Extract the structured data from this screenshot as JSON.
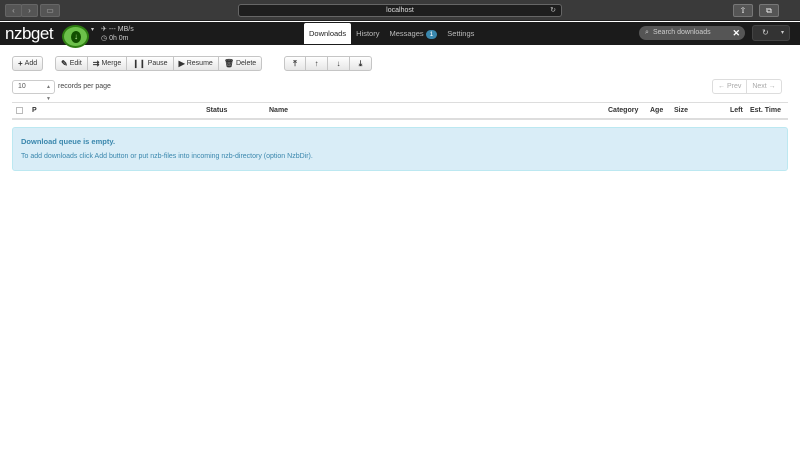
{
  "browser": {
    "back_glyph": "‹",
    "forward_glyph": "›",
    "sidebar_glyph": "▭",
    "address": "localhost",
    "reload_glyph": "↻",
    "share_glyph": "⇧",
    "tabs_glyph": "⧉"
  },
  "navbar": {
    "brand": "nzbget",
    "status_icon": "download-arrow-icon",
    "speed": "--- MB/s",
    "time": "0h 0m",
    "tabs": [
      {
        "label": "Downloads",
        "active": true
      },
      {
        "label": "History",
        "active": false
      },
      {
        "label": "Messages",
        "active": false,
        "badge": "1"
      },
      {
        "label": "Settings",
        "active": false
      }
    ],
    "search_placeholder": "Search downloads",
    "refresh_glyph": "↻",
    "caret_glyph": "▾"
  },
  "toolbar": {
    "add": "Add",
    "edit": "Edit",
    "merge": "Merge",
    "pause": "Pause",
    "resume": "Resume",
    "delete": "Delete"
  },
  "paging": {
    "per_page_value": "10",
    "per_page_label": "records per page",
    "prev": "← Prev",
    "next": "Next →"
  },
  "table": {
    "columns": [
      "P",
      "Status",
      "Name",
      "Category",
      "Age",
      "Size",
      "Left",
      "Est. Time"
    ]
  },
  "empty_alert": {
    "title": "Download queue is empty.",
    "text": "To add downloads click Add button or put nzb-files into incoming nzb-directory (option NzbDir)."
  },
  "colors": {
    "navbar": "#1b1b1b",
    "status_green": "#6cc04a",
    "alert_bg": "#d9edf7",
    "alert_text": "#3a87ad",
    "badge": "#3a87ad"
  }
}
